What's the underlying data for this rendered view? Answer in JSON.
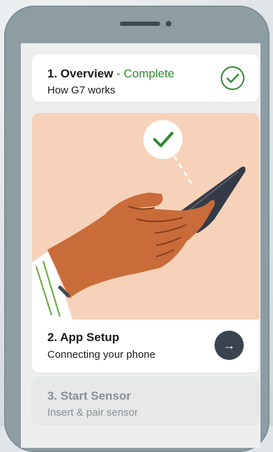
{
  "colors": {
    "complete_green": "#2c8a2e",
    "illustration_bg": "#f6d2ba",
    "arrow_button": "#3a4450",
    "phone_frame": "#8e9da3"
  },
  "steps": [
    {
      "title": "1. Overview",
      "separator": " - ",
      "status": "Complete",
      "subtitle": "How G7 works",
      "icon": "check-circle-icon"
    },
    {
      "title": "2. App Setup",
      "subtitle": "Connecting your phone",
      "icon": "arrow-right-icon",
      "arrow": "→"
    },
    {
      "title": "3. Start Sensor",
      "subtitle": "Insert & pair sensor"
    }
  ]
}
